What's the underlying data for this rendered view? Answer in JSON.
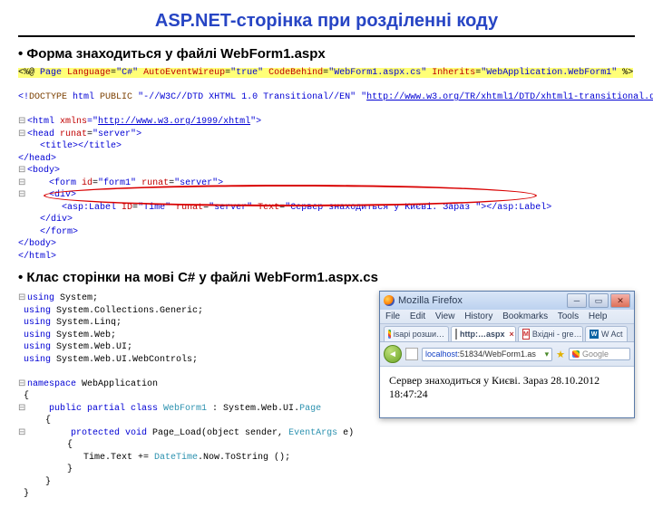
{
  "title": "ASP.NET-сторінка при розділенні коду",
  "bullet1": "Форма знаходиться у файлі WebForm1.aspx",
  "bullet2": "Клас сторінки на мові C# у файлі WebForm1.aspx.cs",
  "aspx": {
    "l1_open": "<%@",
    "l1_page": " Page ",
    "l1_a1": "Language",
    "l1_v1": "\"C#\"",
    "l1_a2": "AutoEventWireup",
    "l1_v2": "\"true\"",
    "l1_a3": "CodeBehind",
    "l1_v3": "\"WebForm1.aspx.cs\"",
    "l1_a4": "Inherits",
    "l1_v4": "\"WebApplication.WebForm1\"",
    "l1_close": " %>",
    "doctype_a": "<!",
    "doctype_b": "DOCTYPE",
    "doctype_c": " html ",
    "doctype_d": "PUBLIC",
    "doctype_e": " \"-//W3C//DTD XHTML 1.0 Transitional//EN\" \"",
    "doctype_url": "http://www.w3.org/TR/xhtml1/DTD/xhtml1-transitional.dtd",
    "doctype_f": "\">",
    "html_open_a": "<html ",
    "html_attr": "xmlns",
    "html_eq": "=\"",
    "html_url": "http://www.w3.org/1999/xhtml",
    "html_close": "\">",
    "head_open": "<head ",
    "runat_attr": "runat",
    "runat_val": "\"server\"",
    "gt": ">",
    "title_tag": "    <title></title>",
    "head_close": "</head>",
    "body_open": "<body>",
    "form_open_a": "    <form ",
    "form_id": "id",
    "form_idv": "\"form1\"",
    "div_open": "    <div>",
    "label_a": "        <asp:Label ",
    "label_ID": "ID",
    "label_IDv": "\"Time\"",
    "label_Text": "Text",
    "label_Textv": "\"Сервер знаходиться у Києві. Зараз \"",
    "label_close": "></asp:Label>",
    "div_close": "    </div>",
    "form_close": "    </form>",
    "body_close": "</body>",
    "html_end": "</html>"
  },
  "cs": {
    "using": "using",
    "u1": " System;",
    "u2": " System.Collections.Generic;",
    "u3": " System.Linq;",
    "u4": " System.Web;",
    "u5": " System.Web.UI;",
    "u6": " System.Web.UI.WebControls;",
    "ns": "namespace",
    "nsname": " WebApplication",
    "cls_a": "    public partial class ",
    "cls_name": "WebForm1",
    "cls_b": " : System.Web.UI.",
    "cls_page": "Page",
    "m_a": "        protected void ",
    "m_name": "Page_Load",
    "m_b": "(object sender, ",
    "m_ev": "EventArgs",
    "m_c": " e)",
    "stmt_a": "            Time.Text += ",
    "stmt_dt": "DateTime",
    "stmt_b": ".Now.ToString ();",
    "ob": "{",
    "cb": "}"
  },
  "browser": {
    "app": "Mozilla Firefox",
    "menu": {
      "file": "File",
      "edit": "Edit",
      "view": "View",
      "history": "History",
      "bookmarks": "Bookmarks",
      "tools": "Tools",
      "help": "Help"
    },
    "tabs": {
      "t1": "isapi розши…",
      "t2": "http:…aspx",
      "t3": "Вхідні - gre…",
      "t4": "W Act"
    },
    "addr_prefix": "localhost",
    "addr_rest": ":51834/WebForm1.as",
    "search_placeholder": "Google",
    "content_line1": "Сервер знаходиться у Києві. Зараз 28.10.2012",
    "content_line2": "18:47:24"
  }
}
